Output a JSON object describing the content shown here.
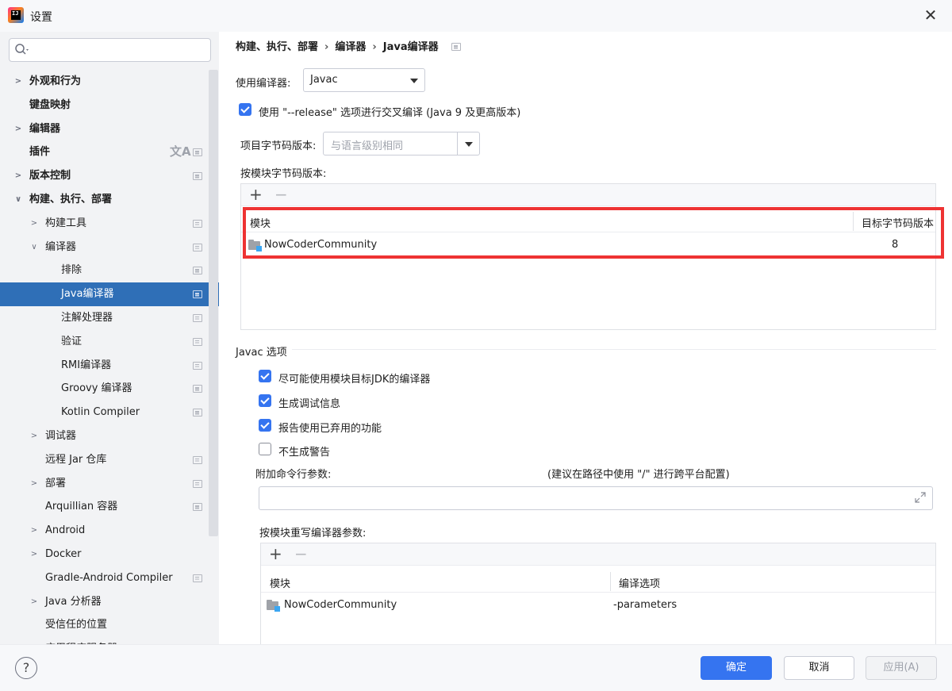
{
  "window": {
    "title": "设置",
    "logo_text": "IJ"
  },
  "search": {
    "placeholder": ""
  },
  "sidebar": {
    "items": [
      {
        "label": "外观和行为"
      },
      {
        "label": "键盘映射"
      },
      {
        "label": "编辑器"
      },
      {
        "label": "插件"
      },
      {
        "label": "版本控制"
      },
      {
        "label": "构建、执行、部署"
      },
      {
        "label": "构建工具"
      },
      {
        "label": "编译器"
      },
      {
        "label": "排除"
      },
      {
        "label": "Java编译器"
      },
      {
        "label": "注解处理器"
      },
      {
        "label": "验证"
      },
      {
        "label": "RMI编译器"
      },
      {
        "label": "Groovy 编译器"
      },
      {
        "label": "Kotlin Compiler"
      },
      {
        "label": "调试器"
      },
      {
        "label": "远程 Jar 仓库"
      },
      {
        "label": "部署"
      },
      {
        "label": "Arquillian 容器"
      },
      {
        "label": "Android"
      },
      {
        "label": "Docker"
      },
      {
        "label": "Gradle-Android Compiler"
      },
      {
        "label": "Java 分析器"
      },
      {
        "label": "受信任的位置"
      },
      {
        "label": "应用程序服务器"
      }
    ]
  },
  "breadcrumb": {
    "part1": "构建、执行、部署",
    "part2": "编译器",
    "part3": "Java编译器",
    "sep": "›"
  },
  "compiler": {
    "use_compiler_label": "使用编译器:",
    "use_compiler_value": "Javac",
    "release_option_label": "使用 \"--release\" 选项进行交叉编译 (Java 9 及更高版本)",
    "release_option_checked": true,
    "project_bytecode_label": "项目字节码版本:",
    "project_bytecode_placeholder": "与语言级别相同",
    "per_module_bytecode_label": "按模块字节码版本:",
    "bytecode_table": {
      "headers": [
        "模块",
        "目标字节码版本"
      ],
      "rows": [
        {
          "module": "NowCoderCommunity",
          "version": "8"
        }
      ]
    }
  },
  "javac": {
    "section_title": "Javac 选项",
    "options": [
      {
        "label": "尽可能使用模块目标JDK的编译器",
        "checked": true
      },
      {
        "label": "生成调试信息",
        "checked": true
      },
      {
        "label": "报告使用已弃用的功能",
        "checked": true
      },
      {
        "label": "不生成警告",
        "checked": false
      }
    ],
    "cmdline_label": "附加命令行参数:",
    "cmdline_hint": "(建议在路径中使用 \"/\" 进行跨平台配置)",
    "cmdline_value": "",
    "override_label": "按模块重写编译器参数:",
    "override_table": {
      "headers": [
        "模块",
        "编译选项"
      ],
      "rows": [
        {
          "module": "NowCoderCommunity",
          "options": "-parameters"
        }
      ]
    }
  },
  "toolbar": {
    "add": "+",
    "remove": "−"
  },
  "buttons": {
    "ok": "确定",
    "cancel": "取消",
    "apply": "应用(A)",
    "help": "?"
  },
  "colors": {
    "accent": "#3574f0",
    "selection": "#2f6fb7",
    "highlight_box": "#ee3333"
  }
}
